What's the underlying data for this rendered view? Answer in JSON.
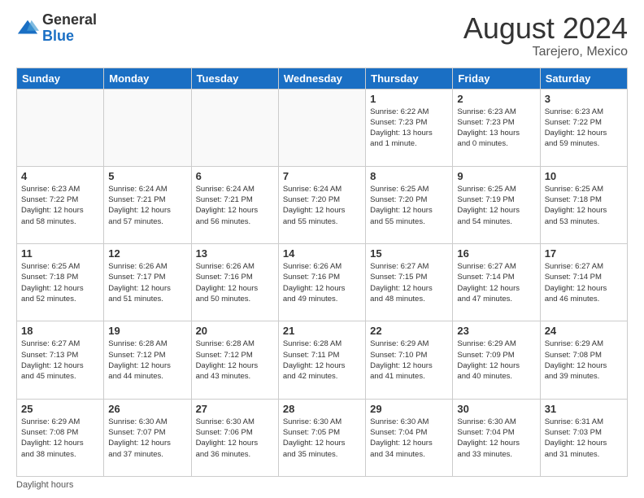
{
  "logo": {
    "general": "General",
    "blue": "Blue"
  },
  "header": {
    "month": "August 2024",
    "location": "Tarejero, Mexico"
  },
  "days_of_week": [
    "Sunday",
    "Monday",
    "Tuesday",
    "Wednesday",
    "Thursday",
    "Friday",
    "Saturday"
  ],
  "footer": {
    "daylight_label": "Daylight hours"
  },
  "weeks": [
    [
      {
        "day": "",
        "info": ""
      },
      {
        "day": "",
        "info": ""
      },
      {
        "day": "",
        "info": ""
      },
      {
        "day": "",
        "info": ""
      },
      {
        "day": "1",
        "info": "Sunrise: 6:22 AM\nSunset: 7:23 PM\nDaylight: 13 hours\nand 1 minute."
      },
      {
        "day": "2",
        "info": "Sunrise: 6:23 AM\nSunset: 7:23 PM\nDaylight: 13 hours\nand 0 minutes."
      },
      {
        "day": "3",
        "info": "Sunrise: 6:23 AM\nSunset: 7:22 PM\nDaylight: 12 hours\nand 59 minutes."
      }
    ],
    [
      {
        "day": "4",
        "info": "Sunrise: 6:23 AM\nSunset: 7:22 PM\nDaylight: 12 hours\nand 58 minutes."
      },
      {
        "day": "5",
        "info": "Sunrise: 6:24 AM\nSunset: 7:21 PM\nDaylight: 12 hours\nand 57 minutes."
      },
      {
        "day": "6",
        "info": "Sunrise: 6:24 AM\nSunset: 7:21 PM\nDaylight: 12 hours\nand 56 minutes."
      },
      {
        "day": "7",
        "info": "Sunrise: 6:24 AM\nSunset: 7:20 PM\nDaylight: 12 hours\nand 55 minutes."
      },
      {
        "day": "8",
        "info": "Sunrise: 6:25 AM\nSunset: 7:20 PM\nDaylight: 12 hours\nand 55 minutes."
      },
      {
        "day": "9",
        "info": "Sunrise: 6:25 AM\nSunset: 7:19 PM\nDaylight: 12 hours\nand 54 minutes."
      },
      {
        "day": "10",
        "info": "Sunrise: 6:25 AM\nSunset: 7:18 PM\nDaylight: 12 hours\nand 53 minutes."
      }
    ],
    [
      {
        "day": "11",
        "info": "Sunrise: 6:25 AM\nSunset: 7:18 PM\nDaylight: 12 hours\nand 52 minutes."
      },
      {
        "day": "12",
        "info": "Sunrise: 6:26 AM\nSunset: 7:17 PM\nDaylight: 12 hours\nand 51 minutes."
      },
      {
        "day": "13",
        "info": "Sunrise: 6:26 AM\nSunset: 7:16 PM\nDaylight: 12 hours\nand 50 minutes."
      },
      {
        "day": "14",
        "info": "Sunrise: 6:26 AM\nSunset: 7:16 PM\nDaylight: 12 hours\nand 49 minutes."
      },
      {
        "day": "15",
        "info": "Sunrise: 6:27 AM\nSunset: 7:15 PM\nDaylight: 12 hours\nand 48 minutes."
      },
      {
        "day": "16",
        "info": "Sunrise: 6:27 AM\nSunset: 7:14 PM\nDaylight: 12 hours\nand 47 minutes."
      },
      {
        "day": "17",
        "info": "Sunrise: 6:27 AM\nSunset: 7:14 PM\nDaylight: 12 hours\nand 46 minutes."
      }
    ],
    [
      {
        "day": "18",
        "info": "Sunrise: 6:27 AM\nSunset: 7:13 PM\nDaylight: 12 hours\nand 45 minutes."
      },
      {
        "day": "19",
        "info": "Sunrise: 6:28 AM\nSunset: 7:12 PM\nDaylight: 12 hours\nand 44 minutes."
      },
      {
        "day": "20",
        "info": "Sunrise: 6:28 AM\nSunset: 7:12 PM\nDaylight: 12 hours\nand 43 minutes."
      },
      {
        "day": "21",
        "info": "Sunrise: 6:28 AM\nSunset: 7:11 PM\nDaylight: 12 hours\nand 42 minutes."
      },
      {
        "day": "22",
        "info": "Sunrise: 6:29 AM\nSunset: 7:10 PM\nDaylight: 12 hours\nand 41 minutes."
      },
      {
        "day": "23",
        "info": "Sunrise: 6:29 AM\nSunset: 7:09 PM\nDaylight: 12 hours\nand 40 minutes."
      },
      {
        "day": "24",
        "info": "Sunrise: 6:29 AM\nSunset: 7:08 PM\nDaylight: 12 hours\nand 39 minutes."
      }
    ],
    [
      {
        "day": "25",
        "info": "Sunrise: 6:29 AM\nSunset: 7:08 PM\nDaylight: 12 hours\nand 38 minutes."
      },
      {
        "day": "26",
        "info": "Sunrise: 6:30 AM\nSunset: 7:07 PM\nDaylight: 12 hours\nand 37 minutes."
      },
      {
        "day": "27",
        "info": "Sunrise: 6:30 AM\nSunset: 7:06 PM\nDaylight: 12 hours\nand 36 minutes."
      },
      {
        "day": "28",
        "info": "Sunrise: 6:30 AM\nSunset: 7:05 PM\nDaylight: 12 hours\nand 35 minutes."
      },
      {
        "day": "29",
        "info": "Sunrise: 6:30 AM\nSunset: 7:04 PM\nDaylight: 12 hours\nand 34 minutes."
      },
      {
        "day": "30",
        "info": "Sunrise: 6:30 AM\nSunset: 7:04 PM\nDaylight: 12 hours\nand 33 minutes."
      },
      {
        "day": "31",
        "info": "Sunrise: 6:31 AM\nSunset: 7:03 PM\nDaylight: 12 hours\nand 31 minutes."
      }
    ]
  ]
}
